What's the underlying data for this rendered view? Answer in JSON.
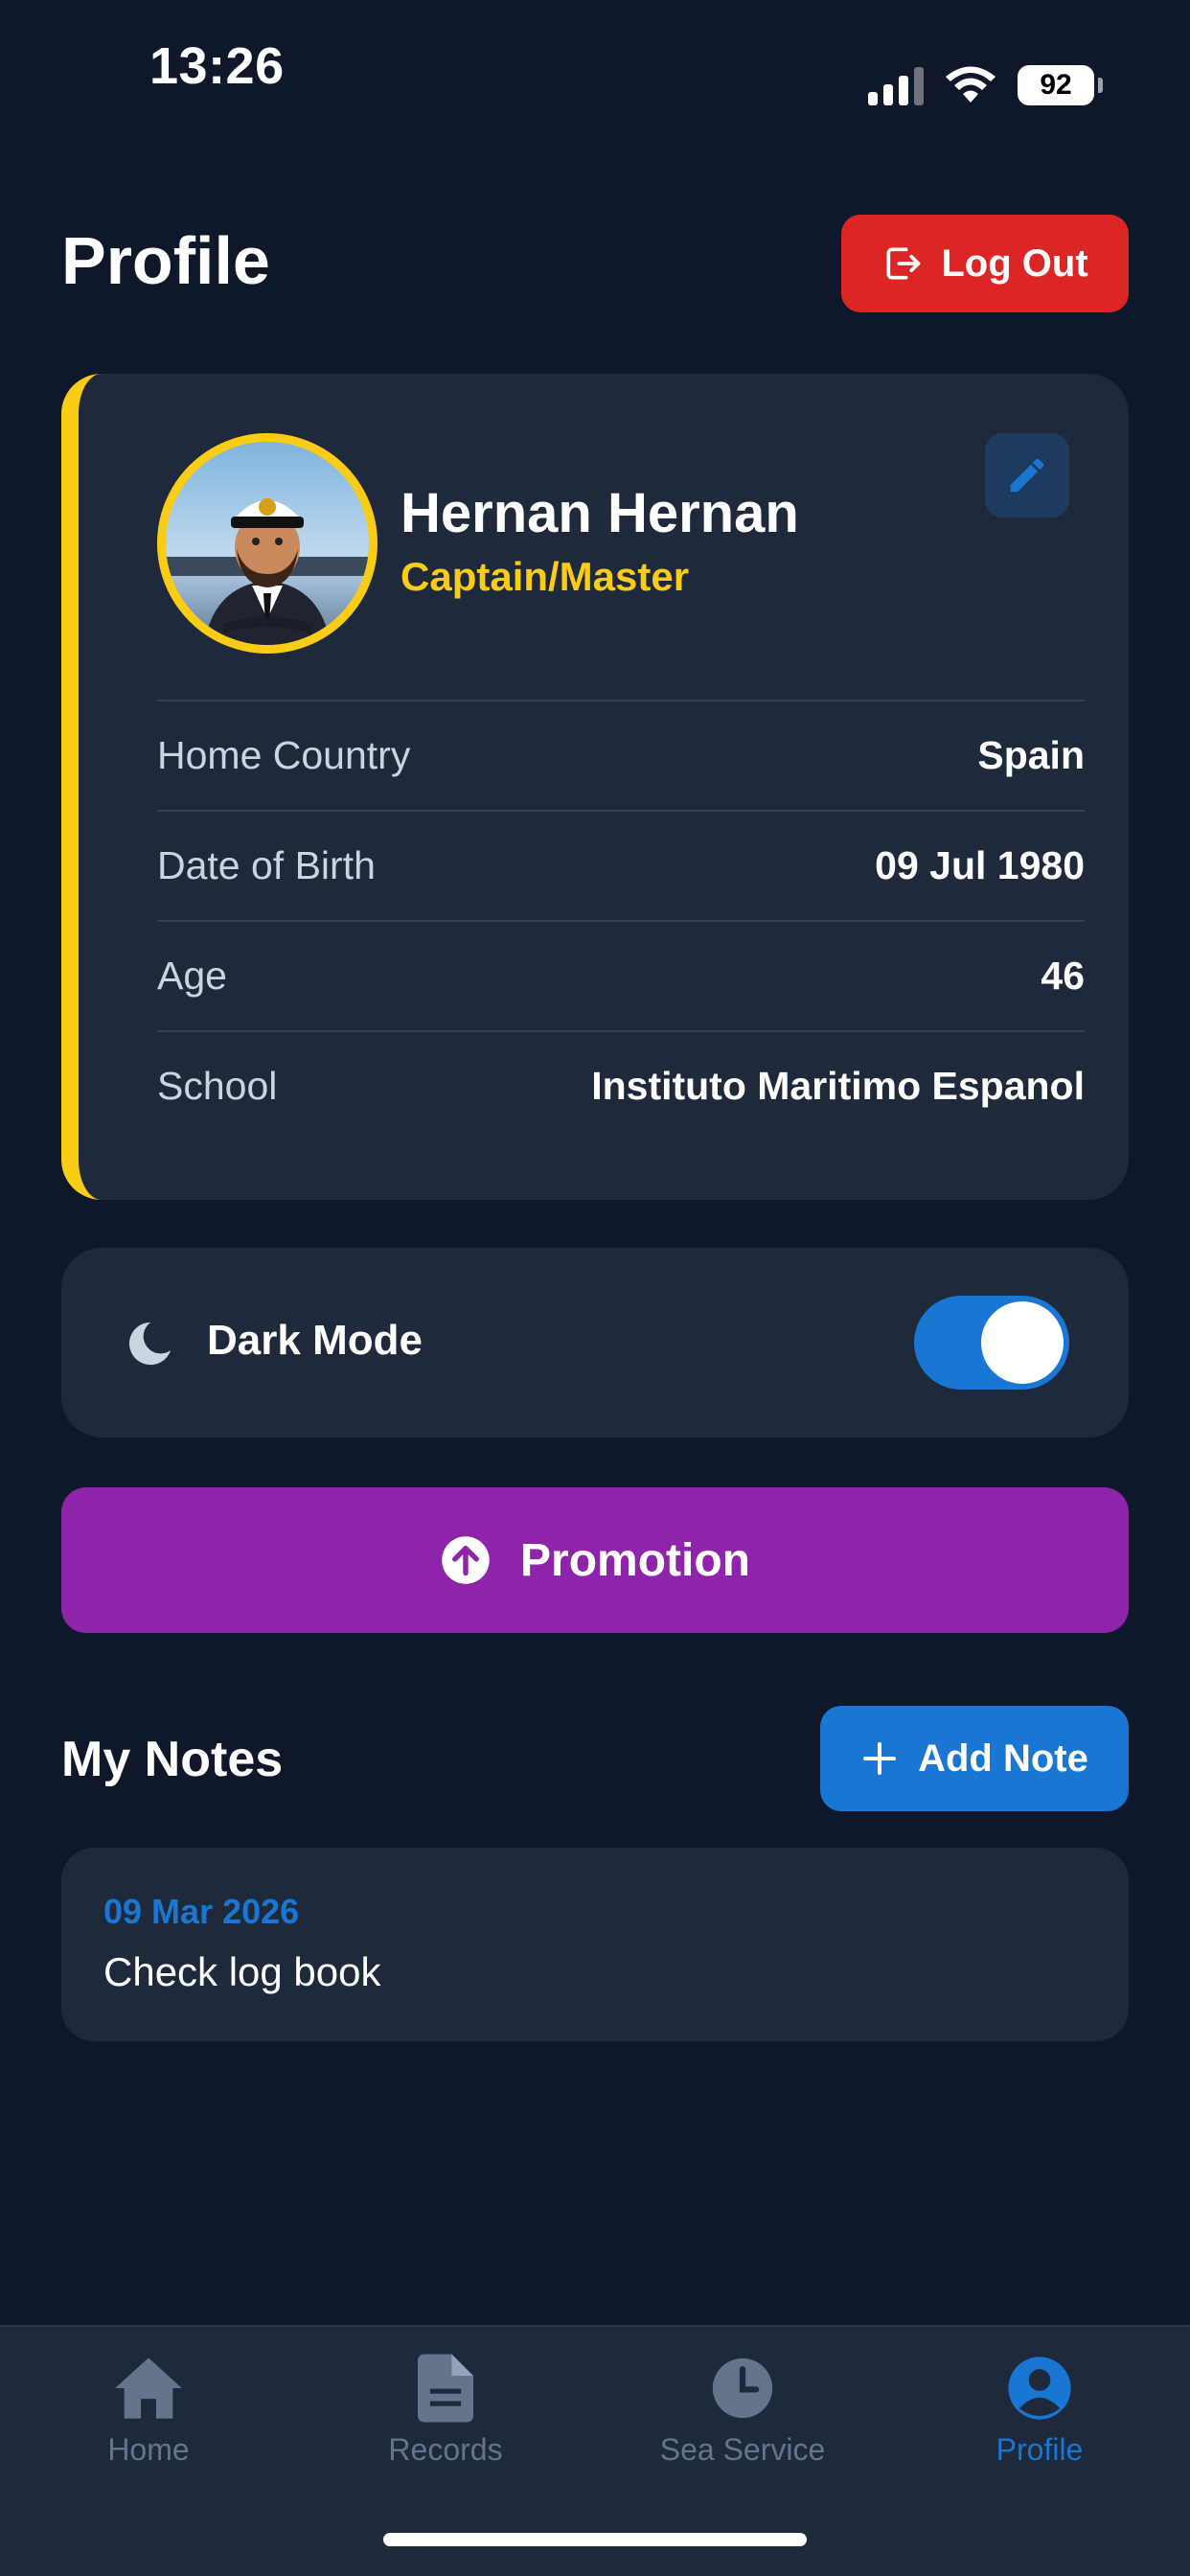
{
  "status_bar": {
    "time": "13:26",
    "battery": "92"
  },
  "header": {
    "title": "Profile",
    "logout_label": "Log Out"
  },
  "profile": {
    "name": "Hernan Hernan",
    "rank": "Captain/Master",
    "details": [
      {
        "label": "Home Country",
        "value": "Spain"
      },
      {
        "label": "Date of Birth",
        "value": "09 Jul 1980"
      },
      {
        "label": "Age",
        "value": "46"
      },
      {
        "label": "School",
        "value": "Instituto Maritimo Espanol"
      }
    ]
  },
  "settings": {
    "dark_mode_label": "Dark Mode",
    "dark_mode_on": true
  },
  "promotion": {
    "label": "Promotion"
  },
  "notes": {
    "title": "My Notes",
    "add_label": "Add Note",
    "items": [
      {
        "date": "09 Mar 2026",
        "text": "Check log book"
      }
    ]
  },
  "tabs": [
    {
      "label": "Home",
      "icon": "home-icon",
      "active": false
    },
    {
      "label": "Records",
      "icon": "document-icon",
      "active": false
    },
    {
      "label": "Sea Service",
      "icon": "clock-icon",
      "active": false
    },
    {
      "label": "Profile",
      "icon": "person-icon",
      "active": true
    }
  ],
  "colors": {
    "background": "#0f172a",
    "card": "#1e293b",
    "accent_yellow": "#facc15",
    "logout_red": "#dc2626",
    "primary_blue": "#1976d2",
    "promotion_purple": "#8e24aa"
  }
}
